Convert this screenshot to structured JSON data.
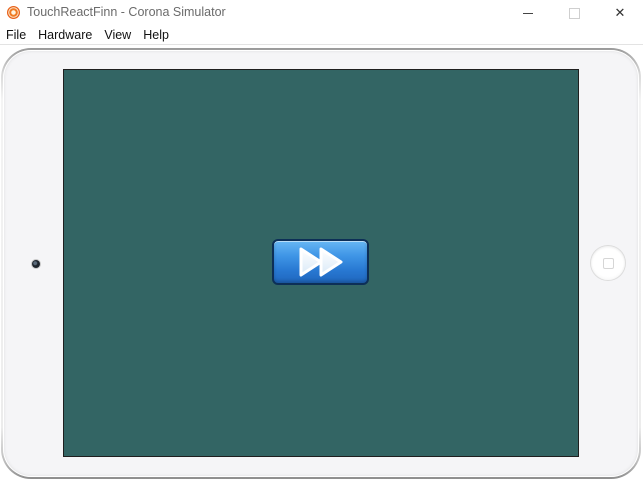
{
  "window": {
    "title": "TouchReactFinn - Corona Simulator",
    "minimize_glyph": "",
    "maximize_glyph": "",
    "close_glyph": "✕"
  },
  "menu": {
    "items": [
      {
        "label": "File"
      },
      {
        "label": "Hardware"
      },
      {
        "label": "View"
      },
      {
        "label": "Help"
      }
    ]
  },
  "device": {
    "model": "iPad",
    "orientation": "landscape",
    "frame_color": "#f5f5f7",
    "screen_background": "#336564"
  },
  "app": {
    "play_button": {
      "icon": "fast-forward-icon",
      "color": "#2f86dc",
      "border_color": "#0d2f57"
    }
  }
}
